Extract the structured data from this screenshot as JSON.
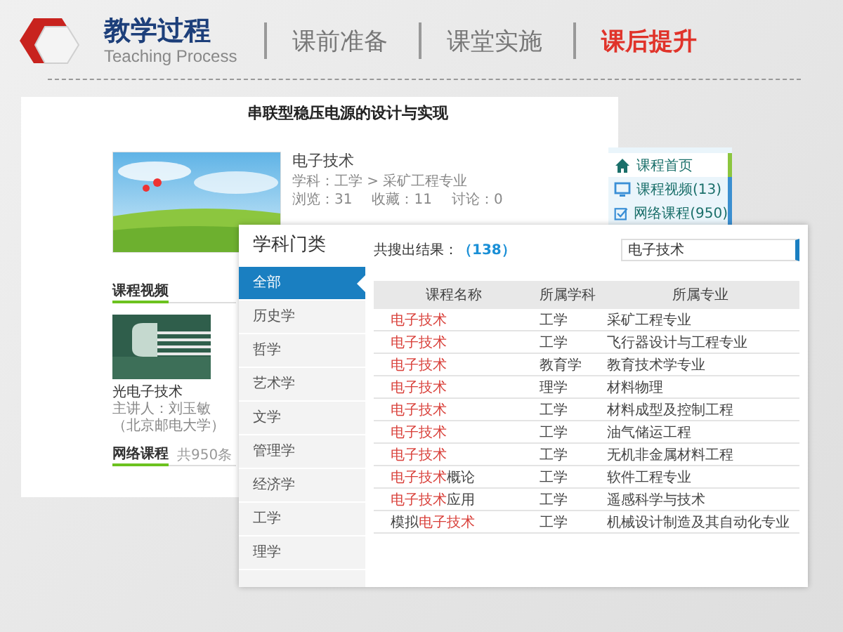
{
  "header": {
    "title": "教学过程",
    "subtitle": "Teaching Process",
    "nav": [
      {
        "label": "课前准备",
        "selected": false
      },
      {
        "label": "课堂实施",
        "selected": false
      },
      {
        "label": "课后提升",
        "selected": true
      }
    ]
  },
  "course_page": {
    "title": "串联型稳压电源的设计与实现",
    "course": {
      "name": "电子技术",
      "subject": "学科：工学 > 采矿工程专业",
      "stats": [
        "浏览：31",
        "收藏：11",
        "讨论：0"
      ]
    },
    "nav": [
      {
        "label": "课程首页",
        "selected": true
      },
      {
        "label": "课程视频(13)",
        "selected": false
      },
      {
        "label": "网络课程(950)",
        "selected": false
      }
    ],
    "video_section": {
      "heading": "课程视频",
      "video_title": "光电子技术",
      "lecturer": "主讲人：刘玉敏（北京邮电大学）"
    },
    "network_section": {
      "heading": "网络课程",
      "count": "共950条"
    }
  },
  "search_panel": {
    "heading": "学科门类",
    "categories": [
      {
        "label": "全部",
        "selected": true
      },
      {
        "label": "历史学",
        "selected": false
      },
      {
        "label": "哲学",
        "selected": false
      },
      {
        "label": "艺术学",
        "selected": false
      },
      {
        "label": "文学",
        "selected": false
      },
      {
        "label": "管理学",
        "selected": false
      },
      {
        "label": "经济学",
        "selected": false
      },
      {
        "label": "工学",
        "selected": false
      },
      {
        "label": "理学",
        "selected": false
      }
    ],
    "result_label": "共搜出结果：",
    "result_count": "（138）",
    "search": {
      "value": "电子技术"
    },
    "table": {
      "columns": [
        "课程名称",
        "所属学科",
        "所属专业"
      ],
      "rows": [
        {
          "name": {
            "match": "电子技术"
          },
          "subject": "工学",
          "major": "采矿工程专业"
        },
        {
          "name": {
            "match": "电子技术"
          },
          "subject": "工学",
          "major": "飞行器设计与工程专业"
        },
        {
          "name": {
            "match": "电子技术"
          },
          "subject": "教育学",
          "major": "教育技术学专业"
        },
        {
          "name": {
            "match": "电子技术"
          },
          "subject": "理学",
          "major": "材料物理"
        },
        {
          "name": {
            "match": "电子技术"
          },
          "subject": "工学",
          "major": "材料成型及控制工程"
        },
        {
          "name": {
            "match": "电子技术"
          },
          "subject": "工学",
          "major": "油气储运工程"
        },
        {
          "name": {
            "match": "电子技术"
          },
          "subject": "工学",
          "major": "无机非金属材料工程"
        },
        {
          "name": {
            "match": "电子技术",
            "suffix": "概论"
          },
          "subject": "工学",
          "major": "软件工程专业"
        },
        {
          "name": {
            "match": "电子技术",
            "suffix": "应用"
          },
          "subject": "工学",
          "major": "遥感科学与技术"
        },
        {
          "name": {
            "prefix": "模拟",
            "match": "电子技术"
          },
          "subject": "工学",
          "major": "机械设计制造及其自动化专业"
        }
      ]
    }
  }
}
